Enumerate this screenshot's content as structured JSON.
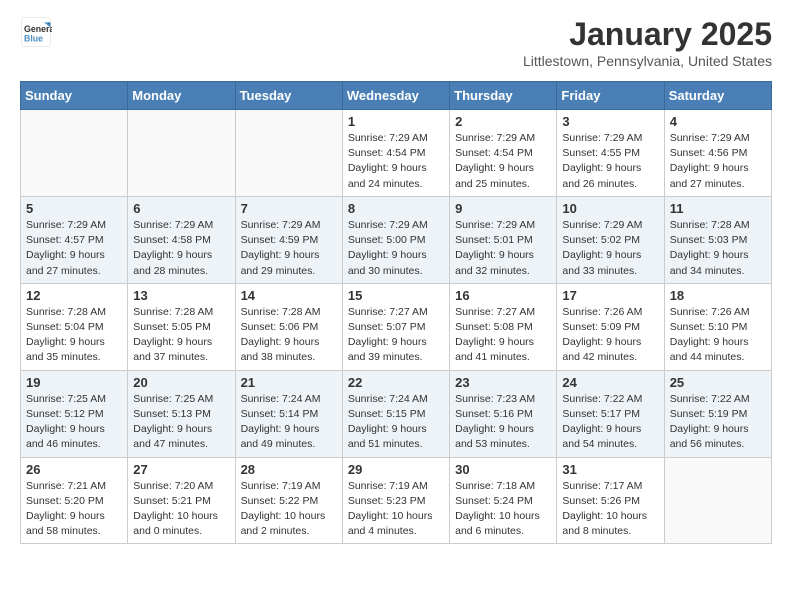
{
  "header": {
    "logo_line1": "General",
    "logo_line2": "Blue",
    "month": "January 2025",
    "location": "Littlestown, Pennsylvania, United States"
  },
  "weekdays": [
    "Sunday",
    "Monday",
    "Tuesday",
    "Wednesday",
    "Thursday",
    "Friday",
    "Saturday"
  ],
  "weeks": [
    [
      {
        "day": "",
        "info": ""
      },
      {
        "day": "",
        "info": ""
      },
      {
        "day": "",
        "info": ""
      },
      {
        "day": "1",
        "info": "Sunrise: 7:29 AM\nSunset: 4:54 PM\nDaylight: 9 hours\nand 24 minutes."
      },
      {
        "day": "2",
        "info": "Sunrise: 7:29 AM\nSunset: 4:54 PM\nDaylight: 9 hours\nand 25 minutes."
      },
      {
        "day": "3",
        "info": "Sunrise: 7:29 AM\nSunset: 4:55 PM\nDaylight: 9 hours\nand 26 minutes."
      },
      {
        "day": "4",
        "info": "Sunrise: 7:29 AM\nSunset: 4:56 PM\nDaylight: 9 hours\nand 27 minutes."
      }
    ],
    [
      {
        "day": "5",
        "info": "Sunrise: 7:29 AM\nSunset: 4:57 PM\nDaylight: 9 hours\nand 27 minutes."
      },
      {
        "day": "6",
        "info": "Sunrise: 7:29 AM\nSunset: 4:58 PM\nDaylight: 9 hours\nand 28 minutes."
      },
      {
        "day": "7",
        "info": "Sunrise: 7:29 AM\nSunset: 4:59 PM\nDaylight: 9 hours\nand 29 minutes."
      },
      {
        "day": "8",
        "info": "Sunrise: 7:29 AM\nSunset: 5:00 PM\nDaylight: 9 hours\nand 30 minutes."
      },
      {
        "day": "9",
        "info": "Sunrise: 7:29 AM\nSunset: 5:01 PM\nDaylight: 9 hours\nand 32 minutes."
      },
      {
        "day": "10",
        "info": "Sunrise: 7:29 AM\nSunset: 5:02 PM\nDaylight: 9 hours\nand 33 minutes."
      },
      {
        "day": "11",
        "info": "Sunrise: 7:28 AM\nSunset: 5:03 PM\nDaylight: 9 hours\nand 34 minutes."
      }
    ],
    [
      {
        "day": "12",
        "info": "Sunrise: 7:28 AM\nSunset: 5:04 PM\nDaylight: 9 hours\nand 35 minutes."
      },
      {
        "day": "13",
        "info": "Sunrise: 7:28 AM\nSunset: 5:05 PM\nDaylight: 9 hours\nand 37 minutes."
      },
      {
        "day": "14",
        "info": "Sunrise: 7:28 AM\nSunset: 5:06 PM\nDaylight: 9 hours\nand 38 minutes."
      },
      {
        "day": "15",
        "info": "Sunrise: 7:27 AM\nSunset: 5:07 PM\nDaylight: 9 hours\nand 39 minutes."
      },
      {
        "day": "16",
        "info": "Sunrise: 7:27 AM\nSunset: 5:08 PM\nDaylight: 9 hours\nand 41 minutes."
      },
      {
        "day": "17",
        "info": "Sunrise: 7:26 AM\nSunset: 5:09 PM\nDaylight: 9 hours\nand 42 minutes."
      },
      {
        "day": "18",
        "info": "Sunrise: 7:26 AM\nSunset: 5:10 PM\nDaylight: 9 hours\nand 44 minutes."
      }
    ],
    [
      {
        "day": "19",
        "info": "Sunrise: 7:25 AM\nSunset: 5:12 PM\nDaylight: 9 hours\nand 46 minutes."
      },
      {
        "day": "20",
        "info": "Sunrise: 7:25 AM\nSunset: 5:13 PM\nDaylight: 9 hours\nand 47 minutes."
      },
      {
        "day": "21",
        "info": "Sunrise: 7:24 AM\nSunset: 5:14 PM\nDaylight: 9 hours\nand 49 minutes."
      },
      {
        "day": "22",
        "info": "Sunrise: 7:24 AM\nSunset: 5:15 PM\nDaylight: 9 hours\nand 51 minutes."
      },
      {
        "day": "23",
        "info": "Sunrise: 7:23 AM\nSunset: 5:16 PM\nDaylight: 9 hours\nand 53 minutes."
      },
      {
        "day": "24",
        "info": "Sunrise: 7:22 AM\nSunset: 5:17 PM\nDaylight: 9 hours\nand 54 minutes."
      },
      {
        "day": "25",
        "info": "Sunrise: 7:22 AM\nSunset: 5:19 PM\nDaylight: 9 hours\nand 56 minutes."
      }
    ],
    [
      {
        "day": "26",
        "info": "Sunrise: 7:21 AM\nSunset: 5:20 PM\nDaylight: 9 hours\nand 58 minutes."
      },
      {
        "day": "27",
        "info": "Sunrise: 7:20 AM\nSunset: 5:21 PM\nDaylight: 10 hours\nand 0 minutes."
      },
      {
        "day": "28",
        "info": "Sunrise: 7:19 AM\nSunset: 5:22 PM\nDaylight: 10 hours\nand 2 minutes."
      },
      {
        "day": "29",
        "info": "Sunrise: 7:19 AM\nSunset: 5:23 PM\nDaylight: 10 hours\nand 4 minutes."
      },
      {
        "day": "30",
        "info": "Sunrise: 7:18 AM\nSunset: 5:24 PM\nDaylight: 10 hours\nand 6 minutes."
      },
      {
        "day": "31",
        "info": "Sunrise: 7:17 AM\nSunset: 5:26 PM\nDaylight: 10 hours\nand 8 minutes."
      },
      {
        "day": "",
        "info": ""
      }
    ]
  ]
}
